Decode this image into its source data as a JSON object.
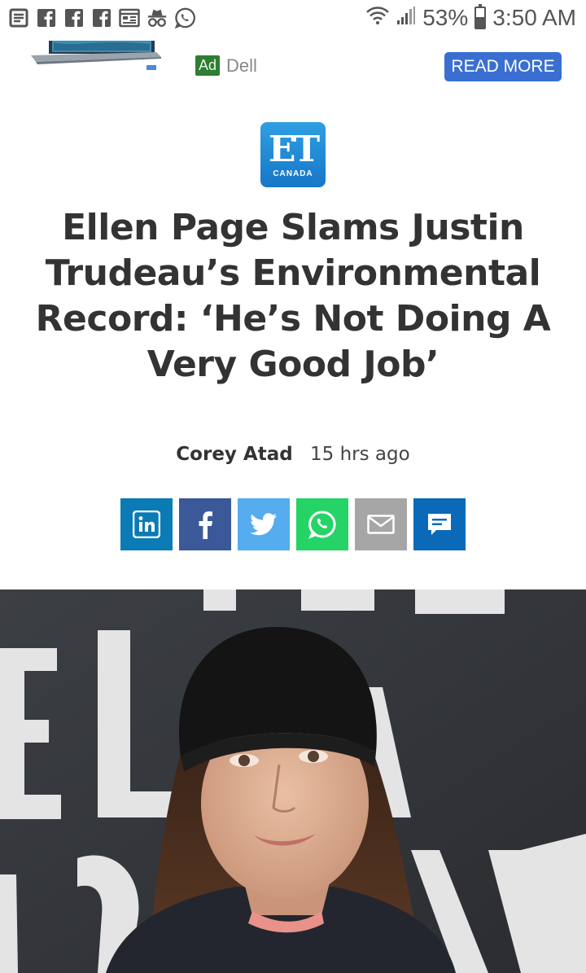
{
  "status_bar": {
    "battery_percent": "53%",
    "battery_level": 0.53,
    "time": "3:50 AM",
    "left_icons": [
      "notes-icon",
      "facebook-icon",
      "facebook-icon",
      "facebook-icon",
      "calendar-icon",
      "incognito-icon",
      "whatsapp-icon"
    ],
    "right_icons": [
      "wifi-icon",
      "signal-icon",
      "battery-icon"
    ]
  },
  "ad": {
    "badge": "Ad",
    "advertiser": "Dell",
    "cta_label": "READ MORE",
    "cta_color": "#3a6fd1"
  },
  "logo": {
    "letters": "ET",
    "sub": "CANADA"
  },
  "article": {
    "headline": "Ellen Page Slams Justin Trudeau’s Environmental Record: ‘He’s Not Doing A Very Good Job’",
    "author": "Corey Atad",
    "time_ago": "15 hrs ago"
  },
  "share": {
    "buttons": [
      {
        "icon": "linkedin-icon",
        "color": "#0a7bb5"
      },
      {
        "icon": "facebook-icon",
        "color": "#3b5998"
      },
      {
        "icon": "twitter-icon",
        "color": "#55acee"
      },
      {
        "icon": "whatsapp-icon",
        "color": "#25d366"
      },
      {
        "icon": "email-icon",
        "color": "#a6a6a6"
      },
      {
        "icon": "comment-icon",
        "color": "#0a6ab8"
      }
    ]
  }
}
